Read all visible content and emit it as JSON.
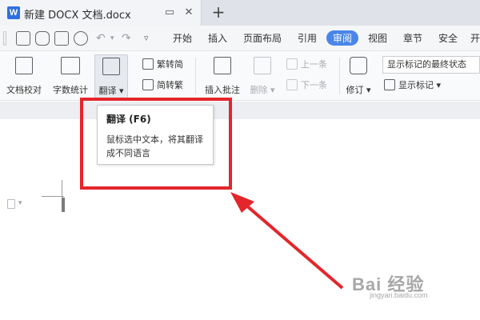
{
  "window": {
    "doc_icon": "W",
    "tab_title": "新建 DOCX 文档.docx",
    "tab_buttons": [
      "▭",
      "✕"
    ],
    "new_tab": "+"
  },
  "menubar": {
    "items": [
      "开始",
      "插入",
      "页面布局",
      "引用",
      "审阅",
      "视图",
      "章节",
      "安全",
      "开"
    ],
    "active": "审阅"
  },
  "ribbon": {
    "proofread": "文档校对",
    "word_count": "字数统计",
    "translate": "翻译",
    "trad_to_simp": "繁转简",
    "simp_to_trad": "简转繁",
    "insert_comment": "插入批注",
    "delete": "删除",
    "prev_item": "上一条",
    "next_item": "下一条",
    "revise": "修订",
    "markup_mode": "显示标记的最终状态",
    "show_markup": "显示标记"
  },
  "tooltip": {
    "title": "翻译 (F6)",
    "body": "鼠标选中文本，将其翻译成不同语言"
  },
  "annotation": {
    "box_color": "#e3262b"
  },
  "watermark": {
    "text": "Bai 经验",
    "sub": "jingyan.baidu.com"
  }
}
